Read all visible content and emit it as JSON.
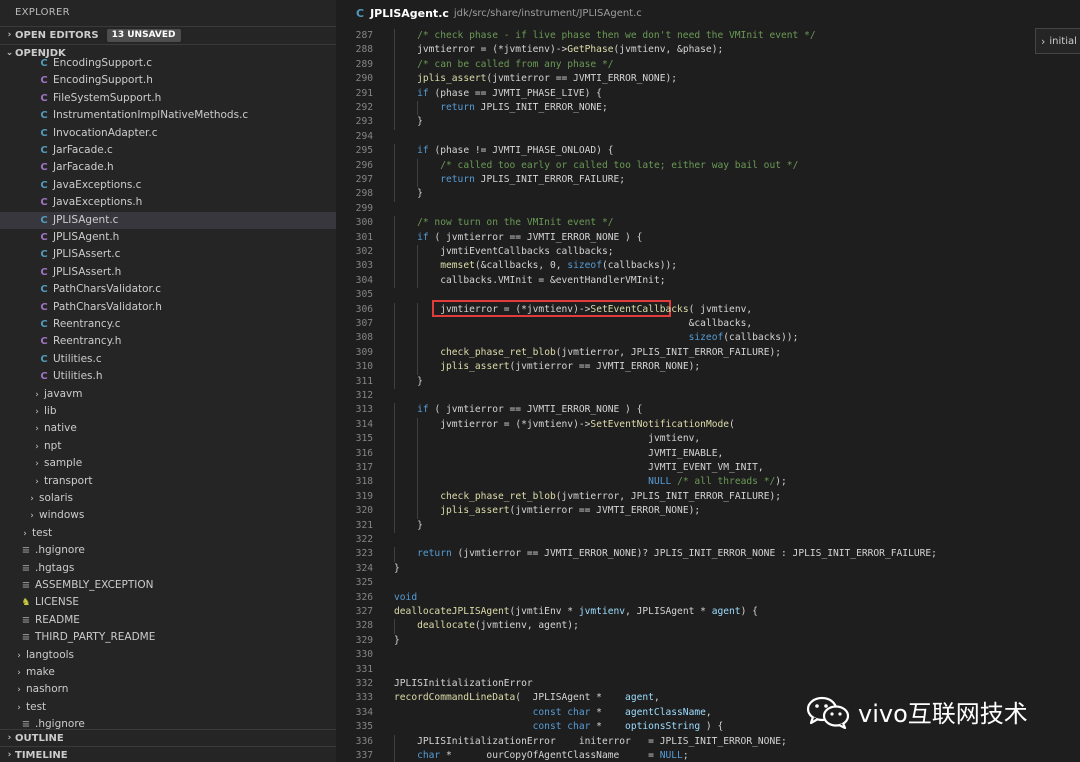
{
  "sidebar": {
    "title": "EXPLORER",
    "open_editors": {
      "label": "OPEN EDITORS",
      "badge": "13 UNSAVED"
    },
    "project": {
      "label": "OPENJDK"
    },
    "outline": {
      "label": "OUTLINE"
    },
    "timeline": {
      "label": "TIMELINE"
    },
    "tree": [
      {
        "label": "EncodingSupport.c",
        "icon": "c",
        "depth": 0
      },
      {
        "label": "EncodingSupport.h",
        "icon": "h",
        "depth": 0
      },
      {
        "label": "FileSystemSupport.h",
        "icon": "h",
        "depth": 0
      },
      {
        "label": "InstrumentationImplNativeMethods.c",
        "icon": "c",
        "depth": 0
      },
      {
        "label": "InvocationAdapter.c",
        "icon": "c",
        "depth": 0
      },
      {
        "label": "JarFacade.c",
        "icon": "c",
        "depth": 0
      },
      {
        "label": "JarFacade.h",
        "icon": "h",
        "depth": 0
      },
      {
        "label": "JavaExceptions.c",
        "icon": "c",
        "depth": 0
      },
      {
        "label": "JavaExceptions.h",
        "icon": "h",
        "depth": 0
      },
      {
        "label": "JPLISAgent.c",
        "icon": "c",
        "depth": 0,
        "selected": true
      },
      {
        "label": "JPLISAgent.h",
        "icon": "h",
        "depth": 0
      },
      {
        "label": "JPLISAssert.c",
        "icon": "c",
        "depth": 0
      },
      {
        "label": "JPLISAssert.h",
        "icon": "h",
        "depth": 0
      },
      {
        "label": "PathCharsValidator.c",
        "icon": "c",
        "depth": 0
      },
      {
        "label": "PathCharsValidator.h",
        "icon": "h",
        "depth": 0
      },
      {
        "label": "Reentrancy.c",
        "icon": "c",
        "depth": 0
      },
      {
        "label": "Reentrancy.h",
        "icon": "h",
        "depth": 0
      },
      {
        "label": "Utilities.c",
        "icon": "c",
        "depth": 0
      },
      {
        "label": "Utilities.h",
        "icon": "h",
        "depth": 0
      },
      {
        "label": "javavm",
        "icon": "folder",
        "depth": 1
      },
      {
        "label": "lib",
        "icon": "folder",
        "depth": 1
      },
      {
        "label": "native",
        "icon": "folder",
        "depth": 1
      },
      {
        "label": "npt",
        "icon": "folder",
        "depth": 1
      },
      {
        "label": "sample",
        "icon": "folder",
        "depth": 1
      },
      {
        "label": "transport",
        "icon": "folder",
        "depth": 1
      },
      {
        "label": "solaris",
        "icon": "folder",
        "depth": 2
      },
      {
        "label": "windows",
        "icon": "folder",
        "depth": 2
      },
      {
        "label": "test",
        "icon": "folder",
        "depth": 3
      },
      {
        "label": ".hgignore",
        "icon": "cfg",
        "depth": 4
      },
      {
        "label": ".hgtags",
        "icon": "cfg",
        "depth": 4
      },
      {
        "label": "ASSEMBLY_EXCEPTION",
        "icon": "cfg",
        "depth": 4
      },
      {
        "label": "LICENSE",
        "icon": "lic",
        "depth": 4
      },
      {
        "label": "README",
        "icon": "cfg",
        "depth": 4
      },
      {
        "label": "THIRD_PARTY_README",
        "icon": "cfg",
        "depth": 4
      },
      {
        "label": "langtools",
        "icon": "folder",
        "depth": 5
      },
      {
        "label": "make",
        "icon": "folder",
        "depth": 5
      },
      {
        "label": "nashorn",
        "icon": "folder",
        "depth": 5
      },
      {
        "label": "test",
        "icon": "folder",
        "depth": 5
      },
      {
        "label": ".hgignore",
        "icon": "cfg",
        "depth": 6
      }
    ]
  },
  "editor": {
    "tab": {
      "name": "JPLISAgent.c",
      "path": "jdk/src/share/instrument/JPLISAgent.c"
    },
    "peek_label": "initial",
    "lines": [
      {
        "n": "287",
        "ind": 1,
        "segs": [
          [
            "cm",
            "/* check phase - if live phase then we don't need the VMInit event */"
          ]
        ]
      },
      {
        "n": "288",
        "ind": 1,
        "segs": [
          [
            "",
            "jvmtierror = (*jvmtienv)->"
          ],
          [
            "f",
            "GetPhase"
          ],
          [
            "",
            "(jvmtienv, &phase);"
          ]
        ]
      },
      {
        "n": "289",
        "ind": 1,
        "segs": [
          [
            "cm",
            "/* can be called from any phase */"
          ]
        ]
      },
      {
        "n": "290",
        "ind": 1,
        "segs": [
          [
            "f",
            "jplis_assert"
          ],
          [
            "",
            "(jvmtierror == JVMTI_ERROR_NONE);"
          ]
        ]
      },
      {
        "n": "291",
        "ind": 1,
        "segs": [
          [
            "k",
            "if"
          ],
          [
            "",
            " (phase == JVMTI_PHASE_LIVE) {"
          ]
        ]
      },
      {
        "n": "292",
        "ind": 2,
        "segs": [
          [
            "k",
            "return"
          ],
          [
            "",
            " JPLIS_INIT_ERROR_NONE;"
          ]
        ]
      },
      {
        "n": "293",
        "ind": 1,
        "segs": [
          [
            "",
            "}"
          ]
        ]
      },
      {
        "n": "294",
        "ind": 0,
        "segs": []
      },
      {
        "n": "295",
        "ind": 1,
        "segs": [
          [
            "k",
            "if"
          ],
          [
            "",
            " (phase != JVMTI_PHASE_ONLOAD) {"
          ]
        ]
      },
      {
        "n": "296",
        "ind": 2,
        "segs": [
          [
            "cm",
            "/* called too early or called too late; either way bail out */"
          ]
        ]
      },
      {
        "n": "297",
        "ind": 2,
        "segs": [
          [
            "k",
            "return"
          ],
          [
            "",
            " JPLIS_INIT_ERROR_FAILURE;"
          ]
        ]
      },
      {
        "n": "298",
        "ind": 1,
        "segs": [
          [
            "",
            "}"
          ]
        ]
      },
      {
        "n": "299",
        "ind": 0,
        "segs": []
      },
      {
        "n": "300",
        "ind": 1,
        "segs": [
          [
            "cm",
            "/* now turn on the VMInit event */"
          ]
        ]
      },
      {
        "n": "301",
        "ind": 1,
        "segs": [
          [
            "k",
            "if"
          ],
          [
            "",
            " ( jvmtierror == JVMTI_ERROR_NONE ) {"
          ]
        ]
      },
      {
        "n": "302",
        "ind": 2,
        "segs": [
          [
            "",
            "jvmtiEventCallbacks callbacks;"
          ]
        ]
      },
      {
        "n": "303",
        "ind": 2,
        "segs": [
          [
            "f",
            "memset"
          ],
          [
            "",
            "(&callbacks, 0, "
          ],
          [
            "k",
            "sizeof"
          ],
          [
            "",
            "(callbacks));"
          ]
        ]
      },
      {
        "n": "304",
        "ind": 2,
        "segs": [
          [
            "",
            "callbacks.VMInit = &eventHandlerVMInit;"
          ]
        ]
      },
      {
        "n": "305",
        "ind": 0,
        "segs": []
      },
      {
        "n": "306",
        "ind": 2,
        "segs": [
          [
            "",
            "jvmtierror = (*jvmtienv)->"
          ],
          [
            "f",
            "SetEventCallbacks"
          ],
          [
            "",
            "( jvmtienv,"
          ]
        ]
      },
      {
        "n": "307",
        "ind": 2,
        "segs": [
          [
            "",
            "                                           &callbacks,"
          ]
        ]
      },
      {
        "n": "308",
        "ind": 2,
        "segs": [
          [
            "",
            "                                           "
          ],
          [
            "k",
            "sizeof"
          ],
          [
            "",
            "(callbacks));"
          ]
        ]
      },
      {
        "n": "309",
        "ind": 2,
        "segs": [
          [
            "f",
            "check_phase_ret_blob"
          ],
          [
            "",
            "(jvmtierror, JPLIS_INIT_ERROR_FAILURE);"
          ]
        ]
      },
      {
        "n": "310",
        "ind": 2,
        "segs": [
          [
            "f",
            "jplis_assert"
          ],
          [
            "",
            "(jvmtierror == JVMTI_ERROR_NONE);"
          ]
        ]
      },
      {
        "n": "311",
        "ind": 1,
        "segs": [
          [
            "",
            "}"
          ]
        ]
      },
      {
        "n": "312",
        "ind": 0,
        "segs": []
      },
      {
        "n": "313",
        "ind": 1,
        "segs": [
          [
            "k",
            "if"
          ],
          [
            "",
            " ( jvmtierror == JVMTI_ERROR_NONE ) {"
          ]
        ]
      },
      {
        "n": "314",
        "ind": 2,
        "segs": [
          [
            "",
            "jvmtierror = (*jvmtienv)->"
          ],
          [
            "f",
            "SetEventNotificationMode"
          ],
          [
            "",
            "("
          ]
        ]
      },
      {
        "n": "315",
        "ind": 2,
        "segs": [
          [
            "",
            "                                    jvmtienv,"
          ]
        ]
      },
      {
        "n": "316",
        "ind": 2,
        "segs": [
          [
            "",
            "                                    JVMTI_ENABLE,"
          ]
        ]
      },
      {
        "n": "317",
        "ind": 2,
        "segs": [
          [
            "",
            "                                    JVMTI_EVENT_VM_INIT,"
          ]
        ]
      },
      {
        "n": "318",
        "ind": 2,
        "segs": [
          [
            "",
            "                                    "
          ],
          [
            "k",
            "NULL"
          ],
          [
            "",
            " "
          ],
          [
            "cm",
            "/* all threads */"
          ],
          [
            "",
            ");"
          ]
        ]
      },
      {
        "n": "319",
        "ind": 2,
        "segs": [
          [
            "f",
            "check_phase_ret_blob"
          ],
          [
            "",
            "(jvmtierror, JPLIS_INIT_ERROR_FAILURE);"
          ]
        ]
      },
      {
        "n": "320",
        "ind": 2,
        "segs": [
          [
            "f",
            "jplis_assert"
          ],
          [
            "",
            "(jvmtierror == JVMTI_ERROR_NONE);"
          ]
        ]
      },
      {
        "n": "321",
        "ind": 1,
        "segs": [
          [
            "",
            "}"
          ]
        ]
      },
      {
        "n": "322",
        "ind": 0,
        "segs": []
      },
      {
        "n": "323",
        "ind": 1,
        "segs": [
          [
            "k",
            "return"
          ],
          [
            "",
            " (jvmtierror == JVMTI_ERROR_NONE)? JPLIS_INIT_ERROR_NONE : JPLIS_INIT_ERROR_FAILURE;"
          ]
        ]
      },
      {
        "n": "324",
        "ind": 0,
        "segs": [
          [
            "",
            "}"
          ]
        ]
      },
      {
        "n": "325",
        "ind": 0,
        "segs": []
      },
      {
        "n": "326",
        "ind": 0,
        "segs": [
          [
            "k",
            "void"
          ]
        ]
      },
      {
        "n": "327",
        "ind": 0,
        "segs": [
          [
            "f",
            "deallocateJPLISAgent"
          ],
          [
            "",
            "(jvmtiEnv * "
          ],
          [
            "vr",
            "jvmtienv"
          ],
          [
            "",
            ", JPLISAgent * "
          ],
          [
            "vr",
            "agent"
          ],
          [
            "",
            ") {"
          ]
        ]
      },
      {
        "n": "328",
        "ind": 1,
        "segs": [
          [
            "f",
            "deallocate"
          ],
          [
            "",
            "(jvmtienv, agent);"
          ]
        ]
      },
      {
        "n": "329",
        "ind": 0,
        "segs": [
          [
            "",
            "}"
          ]
        ]
      },
      {
        "n": "330",
        "ind": 0,
        "segs": []
      },
      {
        "n": "331",
        "ind": 0,
        "segs": []
      },
      {
        "n": "332",
        "ind": 0,
        "segs": [
          [
            "",
            "JPLISInitializationError"
          ]
        ]
      },
      {
        "n": "333",
        "ind": 0,
        "segs": [
          [
            "f",
            "recordCommandLineData"
          ],
          [
            "",
            "(  JPLISAgent *    "
          ],
          [
            "vr",
            "agent"
          ],
          [
            "",
            ","
          ]
        ]
      },
      {
        "n": "334",
        "ind": 0,
        "segs": [
          [
            "",
            "                        "
          ],
          [
            "k",
            "const char"
          ],
          [
            "",
            " *    "
          ],
          [
            "vr",
            "agentClassName"
          ],
          [
            "",
            ","
          ]
        ]
      },
      {
        "n": "335",
        "ind": 0,
        "segs": [
          [
            "",
            "                        "
          ],
          [
            "k",
            "const char"
          ],
          [
            "",
            " *    "
          ],
          [
            "vr",
            "optionsString"
          ],
          [
            "",
            " ) {"
          ]
        ]
      },
      {
        "n": "336",
        "ind": 1,
        "segs": [
          [
            "",
            "JPLISInitializationError    initerror   = JPLIS_INIT_ERROR_NONE;"
          ]
        ]
      },
      {
        "n": "337",
        "ind": 1,
        "segs": [
          [
            "k",
            "char"
          ],
          [
            "",
            " *      ourCopyOfAgentClassName     = "
          ],
          [
            "k",
            "NULL"
          ],
          [
            "",
            ";"
          ]
        ]
      }
    ]
  },
  "watermark": {
    "text": "vivo互联网技术"
  }
}
